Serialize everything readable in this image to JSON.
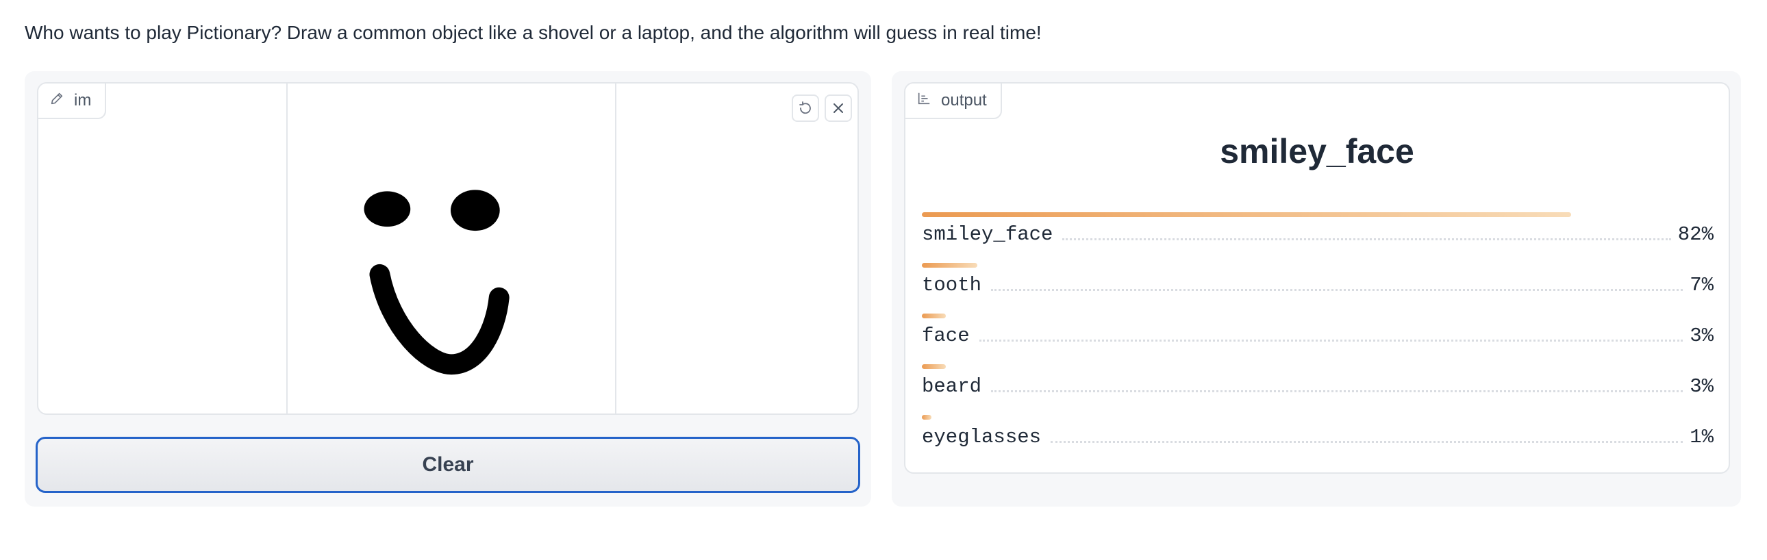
{
  "description": "Who wants to play Pictionary? Draw a common object like a shovel or a laptop, and the algorithm will guess in real time!",
  "input": {
    "label": "im",
    "undo_icon": "undo-icon",
    "clear_icon": "close-icon"
  },
  "clear_button": "Clear",
  "output": {
    "label": "output",
    "top_label": "smiley_face",
    "confidences": [
      {
        "label": "smiley_face",
        "value": "82%",
        "fraction": 0.82
      },
      {
        "label": "tooth",
        "value": "7%",
        "fraction": 0.07
      },
      {
        "label": "face",
        "value": "3%",
        "fraction": 0.03
      },
      {
        "label": "beard",
        "value": "3%",
        "fraction": 0.03
      },
      {
        "label": "eyeglasses",
        "value": "1%",
        "fraction": 0.01
      }
    ]
  },
  "colors": {
    "accent_start": "#eb9a51",
    "accent_end": "#f8dcb8",
    "button_border": "#2563c9"
  }
}
